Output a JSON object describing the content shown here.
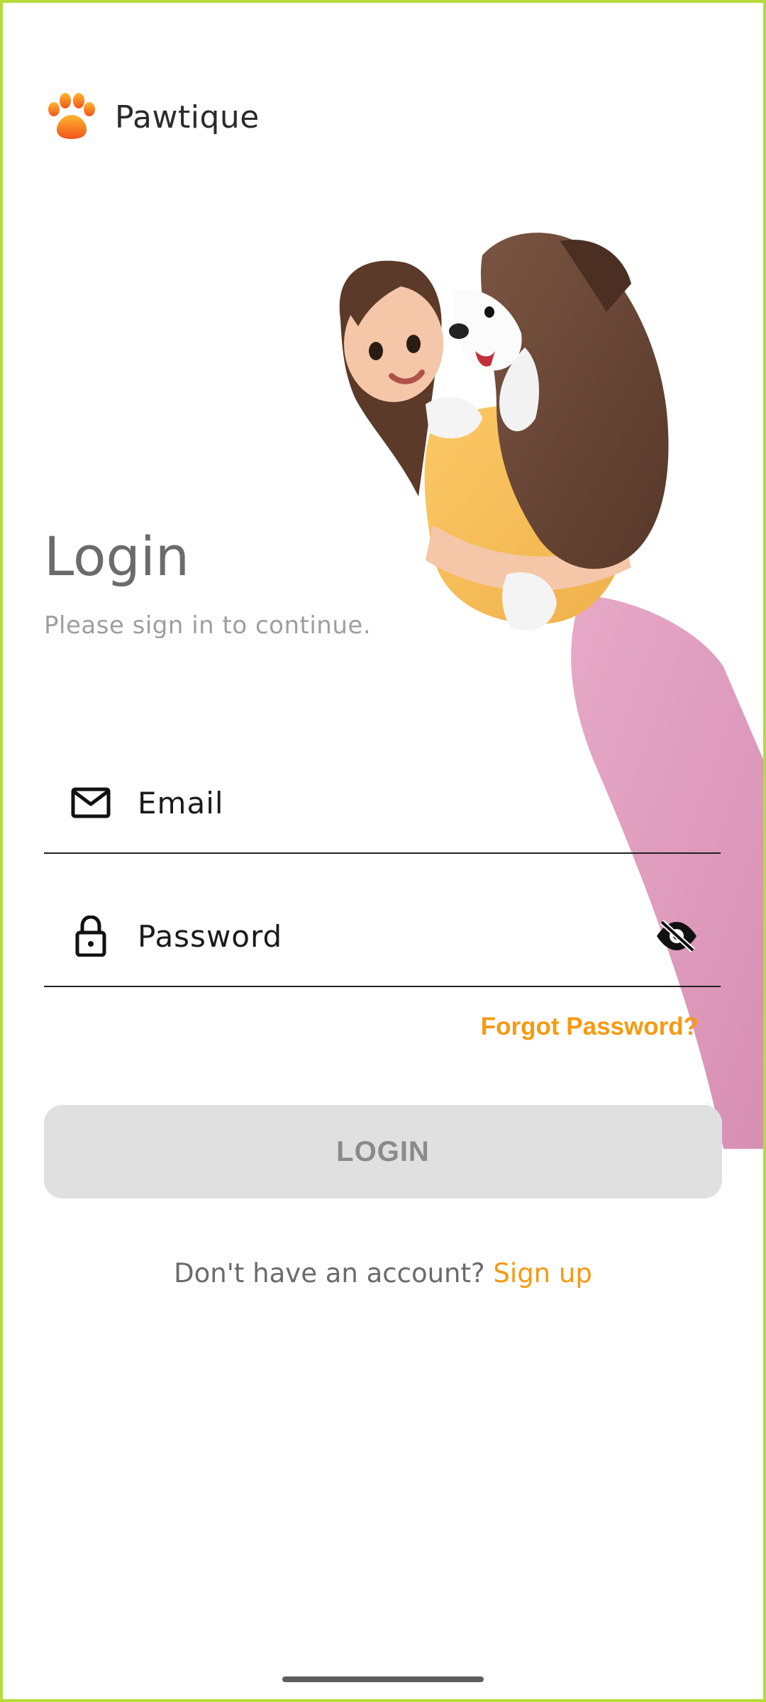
{
  "brand": {
    "name": "Pawtique",
    "logo_icon": "paw-icon",
    "logo_color": "#f97c1c"
  },
  "login": {
    "title": "Login",
    "subtitle": "Please sign in to continue."
  },
  "email_field": {
    "placeholder": "Email",
    "value": "",
    "icon": "mail-icon"
  },
  "password_field": {
    "placeholder": "Password",
    "value": "",
    "icon": "lock-icon",
    "visibility_icon": "eye-off-icon"
  },
  "forgot_password": {
    "label": "Forgot Password?"
  },
  "login_button": {
    "label": "LOGIN",
    "enabled": false
  },
  "signup": {
    "prompt": "Don't have an account?",
    "link": "Sign up"
  },
  "colors": {
    "accent": "#f59a12",
    "button_disabled_bg": "#e0e0e0",
    "button_disabled_text": "#8a8a8a",
    "frame": "#b5dc3a"
  }
}
